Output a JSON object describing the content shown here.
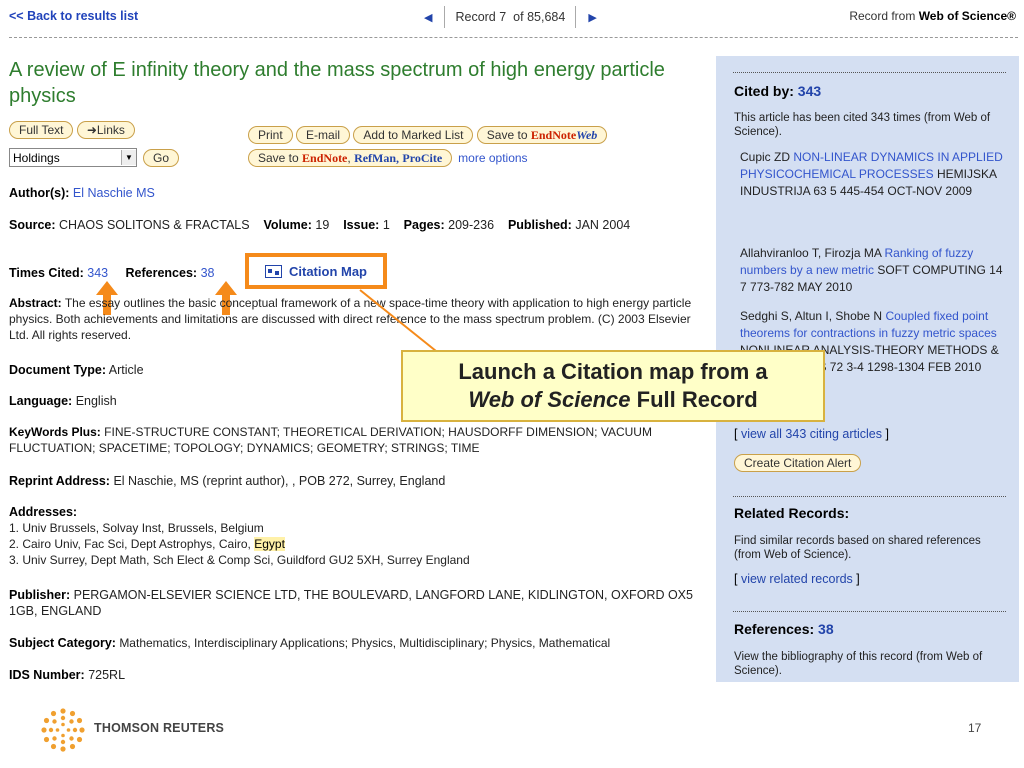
{
  "topbar": {
    "back": "<< Back to results list",
    "record_label": "Record",
    "record_num": "7",
    "record_of": "of",
    "record_total": "85,684",
    "source_prefix": "Record from",
    "source_name": "Web of Science®"
  },
  "article": {
    "title": "A review of E infinity theory and the mass spectrum of high energy particle physics",
    "authors_label": "Author(s):",
    "authors": "El Naschie MS",
    "source_label": "Source:",
    "source": "CHAOS SOLITONS & FRACTALS",
    "volume_label": "Volume:",
    "volume": "19",
    "issue_label": "Issue:",
    "issue": "1",
    "pages_label": "Pages:",
    "pages": "209-236",
    "published_label": "Published:",
    "published": "JAN 2004",
    "times_cited_label": "Times Cited:",
    "times_cited": "343",
    "references_label": "References:",
    "references": "38",
    "citation_map": "Citation Map",
    "abstract_label": "Abstract:",
    "abstract": "The essay outlines the basic conceptual framework of a new space-time theory with application to high energy particle physics. Both achievements and limitations are discussed with direct reference to the mass spectrum problem. (C) 2003 Elsevier Ltd. All rights reserved.",
    "doctype_label": "Document Type:",
    "doctype": "Article",
    "language_label": "Language:",
    "language": "English",
    "keywords_label": "KeyWords Plus:",
    "keywords": "FINE-STRUCTURE CONSTANT; THEORETICAL DERIVATION; HAUSDORFF DIMENSION; VACUUM FLUCTUATION; SPACETIME; TOPOLOGY; DYNAMICS; GEOMETRY; STRINGS; TIME",
    "reprint_label": "Reprint Address:",
    "reprint": "El Naschie, MS (reprint author), , POB 272, Surrey, England",
    "addresses_label": "Addresses:",
    "address1": "1. Univ Brussels, Solvay Inst, Brussels, Belgium",
    "address2_pre": "2. Cairo Univ, Fac Sci, Dept Astrophys, Cairo,",
    "address2_hl": "Egypt",
    "address3": "3. Univ Surrey, Dept Math, Sch Elect & Comp Sci, Guildford GU2 5XH, Surrey England",
    "publisher_label": "Publisher:",
    "publisher": "PERGAMON-ELSEVIER SCIENCE LTD, THE BOULEVARD, LANGFORD LANE, KIDLINGTON, OXFORD OX5 1GB, ENGLAND",
    "subject_label": "Subject Category:",
    "subject": "Mathematics, Interdisciplinary Applications; Physics, Multidisciplinary; Physics, Mathematical",
    "ids_label": "IDS Number:",
    "ids": "725RL"
  },
  "buttons": {
    "full_text": "Full Text",
    "links": "Links",
    "holdings": "Holdings",
    "go": "Go",
    "print": "Print",
    "email": "E-mail",
    "add_marked": "Add to Marked List",
    "save_to": "Save to",
    "endnote": "EndNote",
    "web": "Web",
    "save_to2": "Save to",
    "endnote2": "EndNote",
    "refman": "RefMan,",
    "procite": "ProCite",
    "more_options": "more options"
  },
  "sidebar": {
    "cited_by_label": "Cited by:",
    "cited_by": "343",
    "cited_desc": "This article has been cited 343 times (from Web of Science).",
    "citing": [
      {
        "authors": "Cupic ZD",
        "title": "NON-LINEAR DYNAMICS IN APPLIED PHYSICOCHEMICAL PROCESSES",
        "source": "HEMIJSKA INDUSTRIJA  63  5  445-454  OCT-NOV 2009"
      },
      {
        "authors": "Allahviranloo T, Firozja MA",
        "title": "Ranking of fuzzy numbers by a new metric",
        "source": "SOFT COMPUTING  14  7  773-782  MAY 2010"
      },
      {
        "authors": "Sedghi S, Altun I, Shobe N",
        "title": "Coupled fixed point theorems for contractions in fuzzy metric spaces",
        "source": "NONLINEAR ANALYSIS-THEORY METHODS & APPLICATIONS  72  3-4  1298-1304  FEB 2010"
      }
    ],
    "view_all": "view all 343 citing articles",
    "create_alert": "Create Citation Alert",
    "related_head": "Related Records:",
    "related_desc": "Find similar records based on shared references (from Web of Science).",
    "view_related": "view related records",
    "references_label": "References:",
    "references": "38",
    "references_desc": "View the bibliography of this record (from Web of Science)."
  },
  "callout": {
    "line1": "Launch a Citation map from a",
    "line2_italic": "Web of Science",
    "line2_rest": "Full Record"
  },
  "footer": {
    "brand": "THOMSON REUTERS",
    "page": "17"
  },
  "colors": {
    "title_green": "#2e7d2e",
    "link_blue": "#3355cc",
    "sidebar_bg": "#d4dff2",
    "highlight_orange": "#f58a1a",
    "callout_bg": "#ffffc8"
  }
}
